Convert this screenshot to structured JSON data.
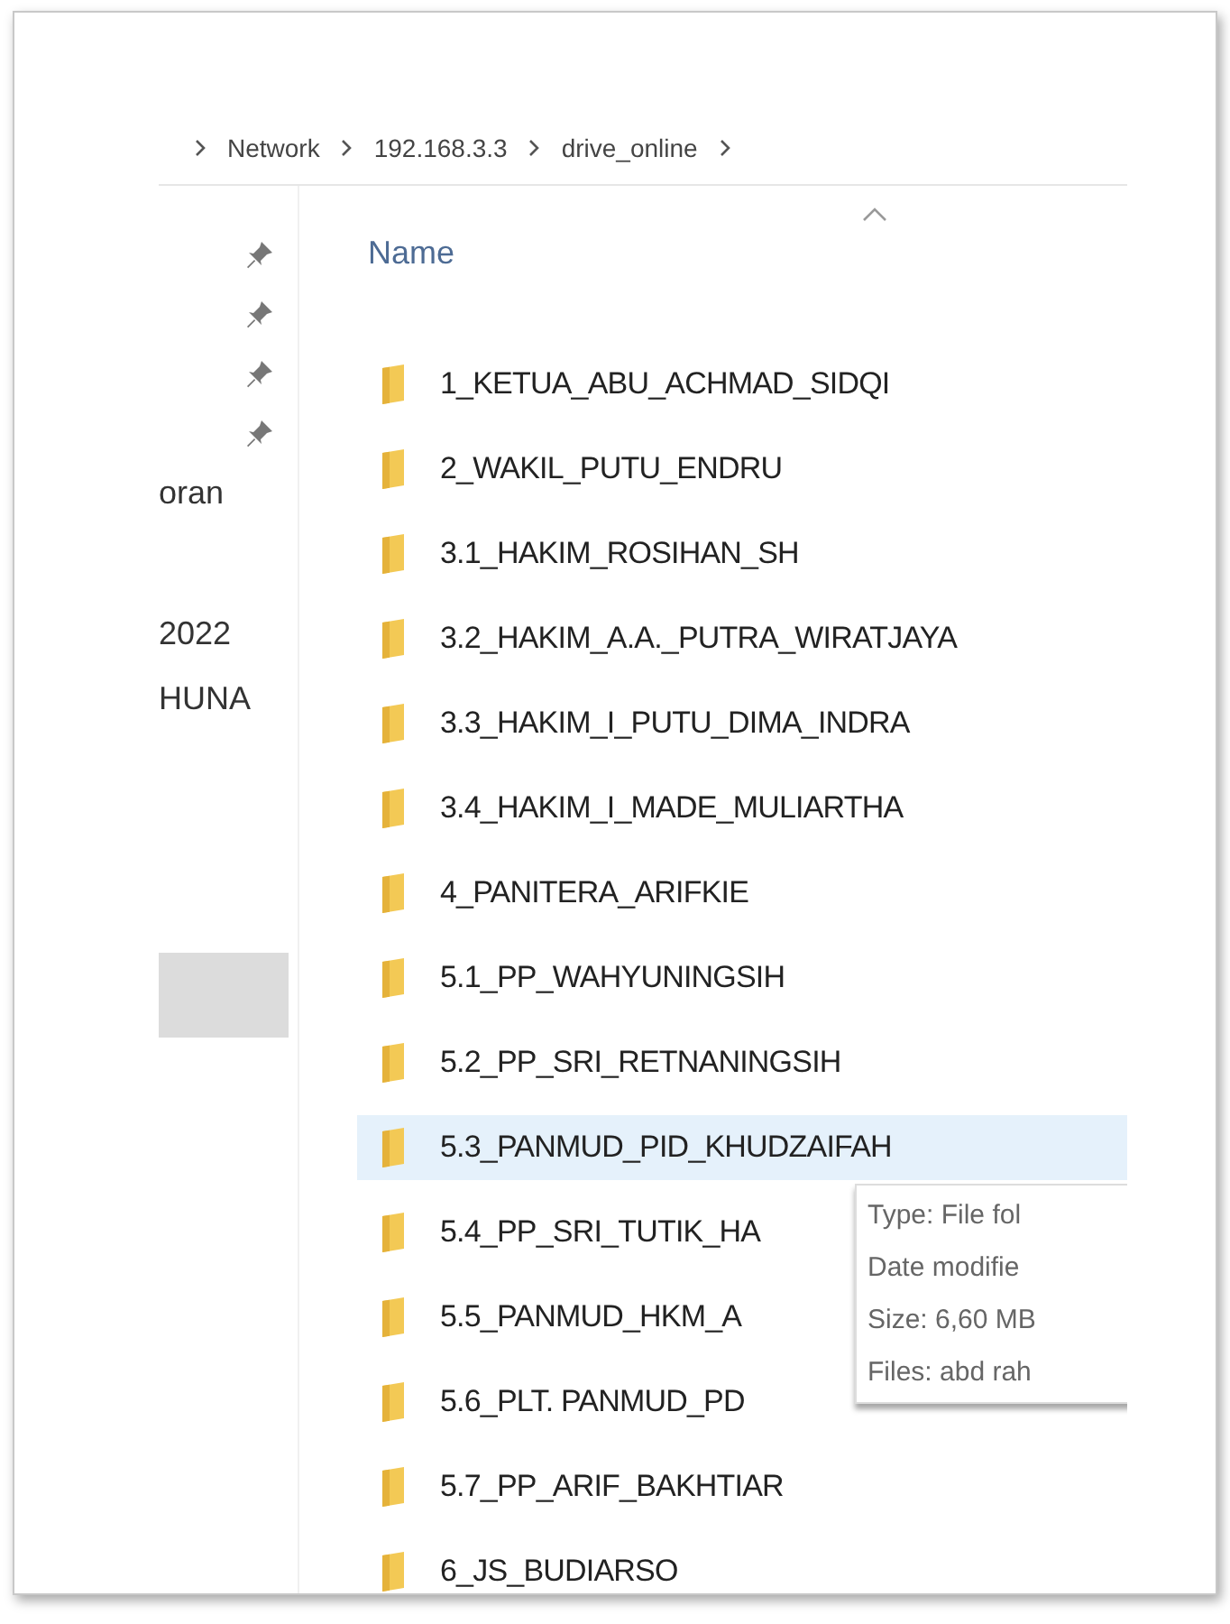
{
  "breadcrumb": [
    {
      "label": "Network"
    },
    {
      "label": "192.168.3.3"
    },
    {
      "label": "drive_online"
    }
  ],
  "nav": [
    {
      "kind": "pinned"
    },
    {
      "kind": "pinned"
    },
    {
      "kind": "pinned"
    },
    {
      "kind": "pinned"
    },
    {
      "kind": "text",
      "label": "oran"
    },
    {
      "kind": "text",
      "label": "2022"
    },
    {
      "kind": "text",
      "label": "HUNA"
    },
    {
      "kind": "block"
    }
  ],
  "column": {
    "label": "Name",
    "sorted": true
  },
  "rows": [
    {
      "name": "1_KETUA_ABU_ACHMAD_SIDQI",
      "selected": false
    },
    {
      "name": "2_WAKIL_PUTU_ENDRU",
      "selected": false
    },
    {
      "name": "3.1_HAKIM_ROSIHAN_SH",
      "selected": false
    },
    {
      "name": "3.2_HAKIM_A.A._PUTRA_WIRATJAYA",
      "selected": false
    },
    {
      "name": "3.3_HAKIM_I_PUTU_DIMA_INDRA",
      "selected": false
    },
    {
      "name": "3.4_HAKIM_I_MADE_MULIARTHA",
      "selected": false
    },
    {
      "name": "4_PANITERA_ARIFKIE",
      "selected": false
    },
    {
      "name": "5.1_PP_WAHYUNINGSIH",
      "selected": false
    },
    {
      "name": "5.2_PP_SRI_RETNANINGSIH",
      "selected": false
    },
    {
      "name": "5.3_PANMUD_PID_KHUDZAIFAH",
      "selected": true
    },
    {
      "name": "5.4_PP_SRI_TUTIK_HA",
      "selected": false
    },
    {
      "name": "5.5_PANMUD_HKM_A",
      "selected": false
    },
    {
      "name": "5.6_PLT. PANMUD_PD",
      "selected": false
    },
    {
      "name": "5.7_PP_ARIF_BAKHTIAR",
      "selected": false
    },
    {
      "name": "6_JS_BUDIARSO",
      "selected": false
    }
  ],
  "tooltip": [
    "Type: File fol",
    "Date modifie",
    "Size: 6,60 MB",
    "Files: abd rah"
  ]
}
